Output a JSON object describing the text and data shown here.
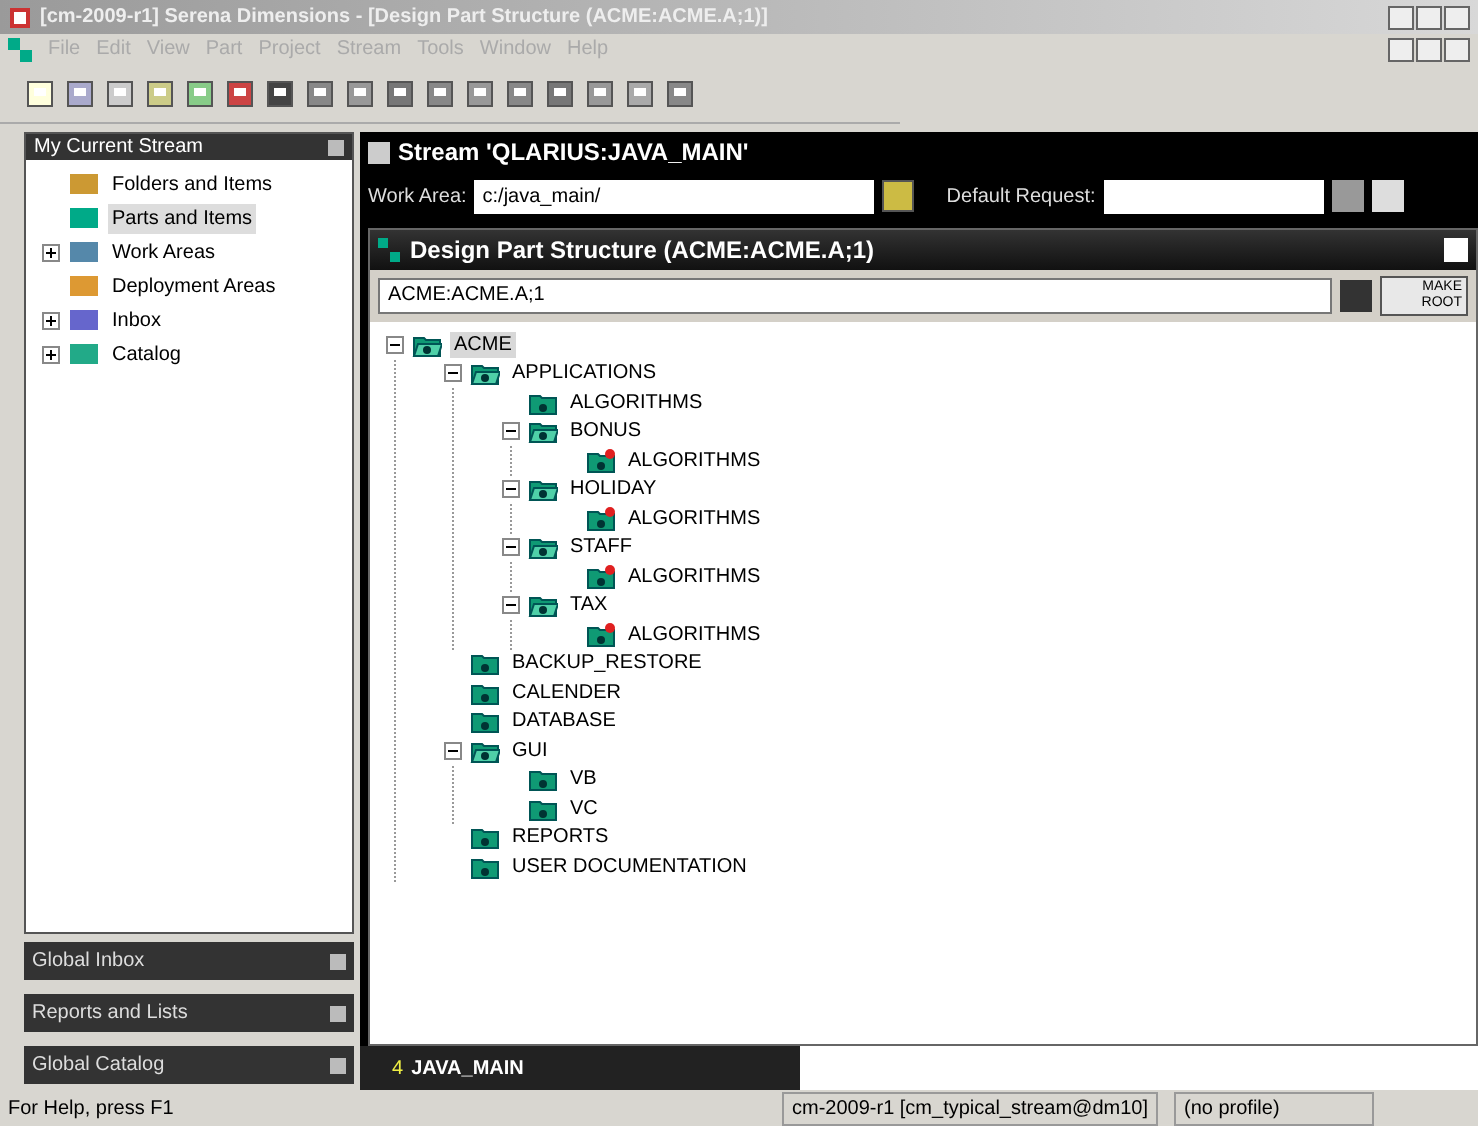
{
  "window": {
    "title": "[cm-2009-r1] Serena Dimensions - [Design Part Structure (ACME:ACME.A;1)]"
  },
  "menu": [
    "File",
    "Edit",
    "View",
    "Part",
    "Project",
    "Stream",
    "Tools",
    "Window",
    "Help"
  ],
  "left_panel": {
    "title": "My Current Stream",
    "items": [
      {
        "label": "Folders and Items",
        "selected": false
      },
      {
        "label": "Parts and Items",
        "selected": true
      },
      {
        "label": "Work Areas",
        "selected": false,
        "expanded": false
      },
      {
        "label": "Deployment Areas",
        "selected": false
      },
      {
        "label": "Inbox",
        "selected": false,
        "expanded": false
      },
      {
        "label": "Catalog",
        "selected": false,
        "expanded": false
      }
    ]
  },
  "collapsed_panels": [
    "Global Inbox",
    "Reports and Lists",
    "Global Catalog"
  ],
  "stream": {
    "title": "Stream 'QLARIUS:JAVA_MAIN'",
    "work_area_label": "Work Area:",
    "work_area": "c:/java_main/",
    "default_request_label": "Default Request:"
  },
  "design_part": {
    "title": "Design Part Structure (ACME:ACME.A;1)",
    "selector": "ACME:ACME.A;1",
    "make_root": "MAKE ROOT",
    "tree": [
      {
        "label": "ACME",
        "kind": "folder",
        "selected": true,
        "expanded": true,
        "children": [
          {
            "label": "APPLICATIONS",
            "kind": "folder",
            "selected": false,
            "expanded": true,
            "children": [
              {
                "label": "ALGORITHMS",
                "kind": "folder",
                "selected": false
              },
              {
                "label": "BONUS",
                "kind": "folder",
                "selected": false,
                "expanded": true,
                "children": [
                  {
                    "label": "ALGORITHMS",
                    "kind": "marked",
                    "selected": false
                  }
                ]
              },
              {
                "label": "HOLIDAY",
                "kind": "folder",
                "selected": false,
                "expanded": true,
                "children": [
                  {
                    "label": "ALGORITHMS",
                    "kind": "marked",
                    "selected": false
                  }
                ]
              },
              {
                "label": "STAFF",
                "kind": "folder",
                "selected": false,
                "expanded": true,
                "children": [
                  {
                    "label": "ALGORITHMS",
                    "kind": "marked",
                    "selected": false
                  }
                ]
              },
              {
                "label": "TAX",
                "kind": "folder",
                "selected": false,
                "expanded": true,
                "children": [
                  {
                    "label": "ALGORITHMS",
                    "kind": "marked",
                    "selected": false
                  }
                ]
              }
            ]
          },
          {
            "label": "BACKUP_RESTORE",
            "kind": "folder",
            "selected": false
          },
          {
            "label": "CALENDER",
            "kind": "folder",
            "selected": false
          },
          {
            "label": "DATABASE",
            "kind": "folder",
            "selected": false
          },
          {
            "label": "GUI",
            "kind": "folder",
            "selected": false,
            "expanded": true,
            "children": [
              {
                "label": "VB",
                "kind": "folder",
                "selected": false
              },
              {
                "label": "VC",
                "kind": "folder",
                "selected": false
              }
            ]
          },
          {
            "label": "REPORTS",
            "kind": "folder",
            "selected": false
          },
          {
            "label": "USER DOCUMENTATION",
            "kind": "folder",
            "selected": false
          }
        ]
      }
    ]
  },
  "doc_tabs": [
    {
      "number": "4",
      "label": "JAVA_MAIN",
      "selected": true
    }
  ],
  "status_bar": {
    "help": "For Help, press F1",
    "connection": "cm-2009-r1 [cm_typical_stream@dm10]",
    "profile": "(no profile)"
  }
}
